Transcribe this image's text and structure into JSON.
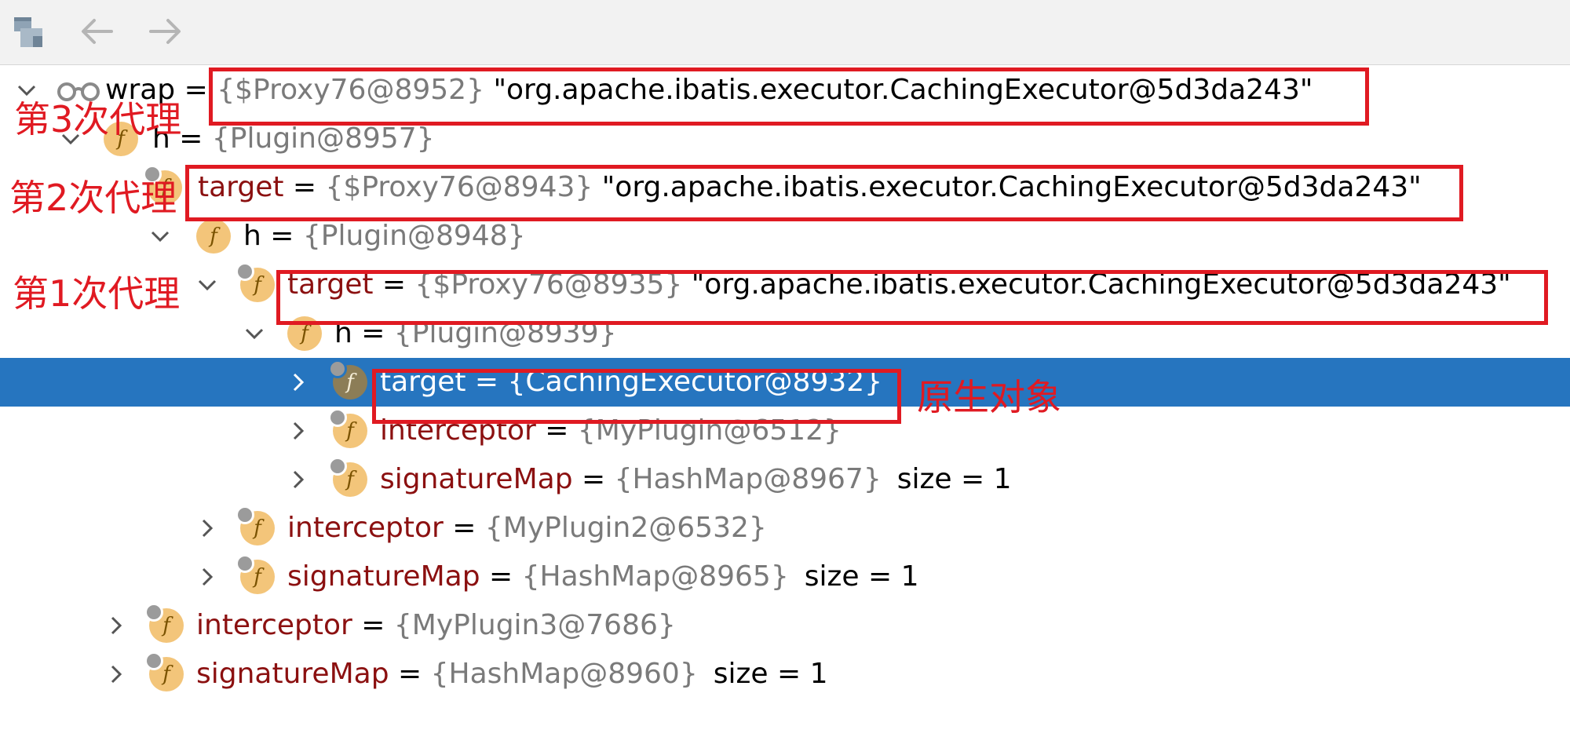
{
  "toolbar": {
    "buttons": [
      {
        "name": "restore-layout-button",
        "icon": "layout-icon"
      },
      {
        "name": "back-button",
        "icon": "arrow-left-icon"
      },
      {
        "name": "forward-button",
        "icon": "arrow-right-icon"
      }
    ]
  },
  "tree": {
    "rows": [
      {
        "name": "wrap",
        "eq": " = ",
        "ref": "{$Proxy76@8952}",
        "str": "\"org.apache.ibatis.executor.CachingExecutor@5d3da243\"",
        "size": ""
      },
      {
        "name": "h",
        "eq": " = ",
        "ref": "{Plugin@8957}",
        "str": "",
        "size": ""
      },
      {
        "name": "target",
        "eq": " = ",
        "ref": "{$Proxy76@8943}",
        "str": "\"org.apache.ibatis.executor.CachingExecutor@5d3da243\"",
        "size": ""
      },
      {
        "name": "h",
        "eq": " = ",
        "ref": "{Plugin@8948}",
        "str": "",
        "size": ""
      },
      {
        "name": "target",
        "eq": " = ",
        "ref": "{$Proxy76@8935}",
        "str": "\"org.apache.ibatis.executor.CachingExecutor@5d3da243\"",
        "size": ""
      },
      {
        "name": "h",
        "eq": " = ",
        "ref": "{Plugin@8939}",
        "str": "",
        "size": ""
      },
      {
        "name": "target",
        "eq": " = ",
        "ref": "{CachingExecutor@8932}",
        "str": "",
        "size": ""
      },
      {
        "name": "interceptor",
        "eq": " = ",
        "ref": "{MyPlugin@6512}",
        "str": "",
        "size": ""
      },
      {
        "name": "signatureMap",
        "eq": " = ",
        "ref": "{HashMap@8967}",
        "str": "",
        "size": "size = 1"
      },
      {
        "name": "interceptor",
        "eq": " = ",
        "ref": "{MyPlugin2@6532}",
        "str": "",
        "size": ""
      },
      {
        "name": "signatureMap",
        "eq": " = ",
        "ref": "{HashMap@8965}",
        "str": "",
        "size": "size = 1"
      },
      {
        "name": "interceptor",
        "eq": " = ",
        "ref": "{MyPlugin3@7686}",
        "str": "",
        "size": ""
      },
      {
        "name": "signatureMap",
        "eq": " = ",
        "ref": "{HashMap@8960}",
        "str": "",
        "size": "size = 1"
      }
    ],
    "field_icon_letter": "f"
  },
  "annotations": {
    "proxy3": "第3次代理",
    "proxy2": "第2次代理",
    "proxy1": "第1次代理",
    "original": "原生对象"
  },
  "colors": {
    "selection": "#2675bf",
    "annotation_red": "#e01a22",
    "field_icon": "#f3c57a",
    "reference_gray": "#7a7a7a",
    "field_name_red": "#8b1010"
  }
}
